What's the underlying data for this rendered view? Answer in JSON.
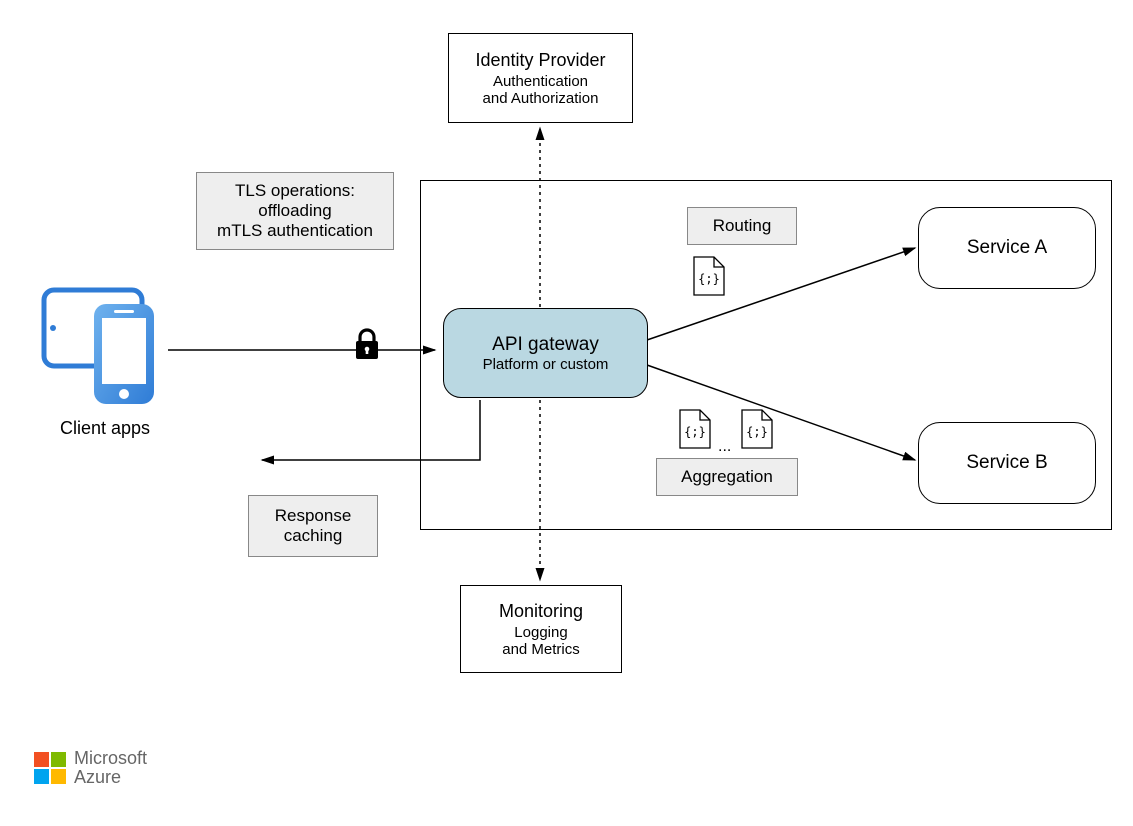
{
  "identity": {
    "title": "Identity Provider",
    "sub1": "Authentication",
    "sub2": "and Authorization"
  },
  "tls": {
    "l1": "TLS operations:",
    "l2": "offloading",
    "l3": "mTLS authentication"
  },
  "client_label": "Client apps",
  "gateway": {
    "title": "API gateway",
    "sub": "Platform or custom"
  },
  "routing_label": "Routing",
  "aggregation_label": "Aggregation",
  "aggregation_dots": "...",
  "service_a": "Service A",
  "service_b": "Service B",
  "response": {
    "l1": "Response",
    "l2": "caching"
  },
  "monitoring": {
    "title": "Monitoring",
    "sub1": "Logging",
    "sub2": "and Metrics"
  },
  "brand": {
    "line1": "Microsoft",
    "line2": "Azure"
  },
  "colors": {
    "gateway_fill": "#bad8e2",
    "ms_red": "#f25022",
    "ms_green": "#7fba00",
    "ms_blue": "#00a4ef",
    "ms_yellow": "#ffb900",
    "device_blue1": "#2f7cd6",
    "device_blue2": "#6fb2ee"
  }
}
